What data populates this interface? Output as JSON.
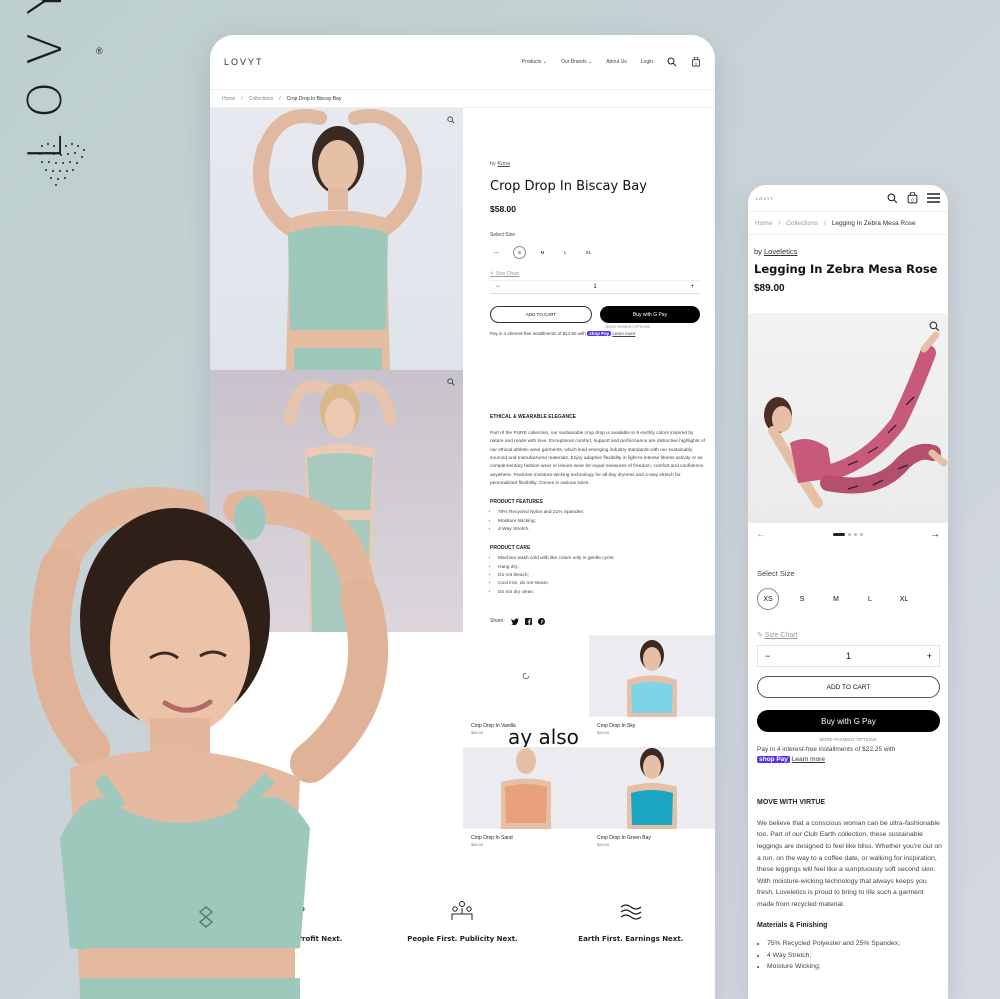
{
  "brand": {
    "name": "LOVYT",
    "registered": "®"
  },
  "desktop": {
    "logo": "LOVYT",
    "nav": [
      "Products",
      "Our Brands",
      "About Us",
      "Login"
    ],
    "cart_count": "0",
    "breadcrumb": [
      "Home",
      "Collections",
      "Crop Drop In Biscay Bay"
    ],
    "product": {
      "by_label": "by",
      "vendor": "Krina",
      "title": "Crop Drop In Biscay Bay",
      "price": "$58.00",
      "select_size_label": "Select Size",
      "sizes": [
        "—",
        "S",
        "M",
        "L",
        "XL"
      ],
      "selected_size": "S",
      "size_chart": "Size Chart",
      "qty": "1",
      "add_to_cart": "ADD TO CART",
      "buy_with": "Buy with",
      "gpay": "G Pay",
      "more_options": "MORE PAYMENT OPTIONS",
      "installments": "Pay in 4 interest-free installments of $14.50 with",
      "shop_pay": "shop Pay",
      "learn_more": "Learn more"
    },
    "description": {
      "heading": "ETHICAL & WEARABLE ELEGANCE",
      "body": "Part of the PURE collection, our sustainable crop drop is available in 9 earthly colors inspired by nature and made with love. Exceptional comfort, support and performance are distinctive highlights of our ethical athletic wear garments, which lead emerging industry standards with our sustainably sourced and manufactured materials. Enjoy adaptive flexibility in light-to-intense fitness activity or as complementary fashion wear or leisure wear for equal measures of freedom, comfort and confidence anywhere. Features moisture-wicking technology for all-day dryness and 4-way stretch for personalized flexibility. Comes in various sizes.",
      "features_heading": "PRODUCT FEATURES",
      "features": [
        "79% Recycled Nylon and 21% Spandex;",
        "Moisture Wicking;",
        "4-Way Stretch."
      ],
      "care_heading": "PRODUCT CARE",
      "care": [
        "Machine wash cold with like colors only in gentle cycle;",
        "Hang dry;",
        "Do not bleach;",
        "Cool iron, do not steam;",
        "Do not dry clean."
      ],
      "share_label": "Share:"
    },
    "also_like": "ay also",
    "related": [
      {
        "name": "Crop Drop In Vanilla",
        "price": "$58.00",
        "color": "#ffffff"
      },
      {
        "name": "Crop Drop In Sky",
        "price": "$58.00",
        "color": "#7fd3e6"
      },
      {
        "name": "Crop Drop In Sand",
        "price": "$58.00",
        "color": "#e9a07c"
      },
      {
        "name": "Crop Drop In Green Bay",
        "price": "$58.00",
        "color": "#1aa6c0"
      }
    ],
    "values": [
      "Planet First. Profit Next.",
      "People First. Publicity Next.",
      "Earth First. Earnings Next."
    ]
  },
  "mobile": {
    "logo": "LOVYT",
    "cart_count": "0",
    "breadcrumb": [
      "Home",
      "Collections",
      "Legging In Zebra Mesa Rose"
    ],
    "product": {
      "by_label": "by",
      "vendor": "Loveletics",
      "title": "Legging In Zebra Mesa Rose",
      "price": "$89.00",
      "select_size_label": "Select Size",
      "sizes": [
        "XS",
        "S",
        "M",
        "L",
        "XL"
      ],
      "selected_size": "XS",
      "size_chart": "Size Chart",
      "qty": "1",
      "add_to_cart": "ADD TO CART",
      "buy_with": "Buy with",
      "gpay": "G Pay",
      "more_options": "MORE PAYMENT OPTIONS",
      "installments": "Pay in 4 interest-free installments of $22.25 with",
      "shop_pay": "shop Pay",
      "learn_more": "Learn more"
    },
    "description": {
      "heading": "MOVE WITH VIRTUE",
      "body": "We believe that a conscious woman can be ultra-fashionable too. Part of our Club Earth collection, these sustainable leggings are designed to feel like bliss. Whether you're out on a run, on the way to a coffee date, or walking for inspiration, these leggings will feel like a sumptuously soft second skin. With moisture-wicking technology that always keeps you fresh, Loveletics is proud to bring to life such a garment made from recycled material.",
      "materials_heading": "Materials & Finishing",
      "materials": [
        "75% Recycled Polyester and 25% Spandex;",
        "4 Way Stretch;",
        "Moisture Wicking;"
      ]
    }
  },
  "colors": {
    "top_mint": "#9fc8bc",
    "legging_pink": "#c75a7a",
    "gpay_black": "#000000",
    "shop_pay": "#5a31f4"
  }
}
